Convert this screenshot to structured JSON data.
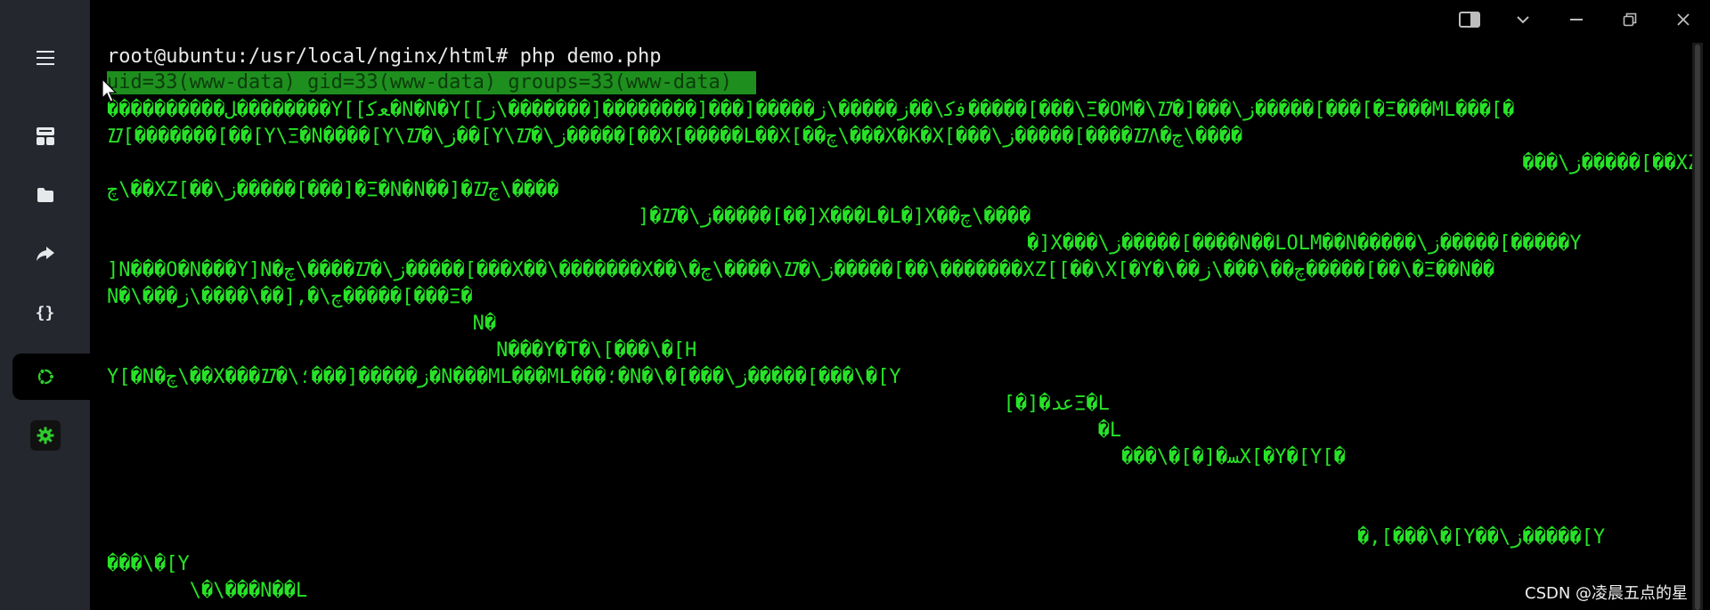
{
  "sidebar": {
    "items": [
      {
        "icon": "menu-icon"
      },
      {
        "icon": "dashboard-icon"
      },
      {
        "icon": "folder-icon"
      },
      {
        "icon": "share-icon"
      },
      {
        "icon": "braces-icon",
        "glyph": "{}"
      },
      {
        "icon": "ubuntu-terminal-icon",
        "active": true
      },
      {
        "icon": "gear-icon"
      }
    ],
    "accent": "#2ecc2e"
  },
  "window_controls": [
    "sidebar-toggle-icon",
    "chevron-down-icon",
    "minimize-icon",
    "restore-icon",
    "close-icon"
  ],
  "terminal": {
    "text_color": "#27e327",
    "prompt": "root@ubuntu:/usr/local/nginx/html# php demo.php",
    "highlight": "uid=33(www-data) gid=33(www-data) groups=33(www-data) ",
    "lines": [
      "����������ﻞ��������Y[[ﻌﮐ�N�N�Y[[ﻓﮐ\\��ﺯ�����\\ﺯ�����[���[��������[�������\\ﺯ�����[���\\Ξ�OM�\\ᮕ�]���\\ﺯ�����[���[�Ξ���ML���[�",
      "ᮕ[�������[��[Y\\Ξ�N����[Y\\ᮕ�\\ﺯ��[Y\\ᮕ�\\ﺯ�����[��X[�����L��X[��ﭺ\\���X�K�X[���\\ﺯ�����[����ᮕΛ�ﭺ\\����",
      "                                                                                                                        ���\\ﺯ�����[��XZ[����XZ[�",
      "ﭺ\\��XZ[��\\ﺯ�����[���]�Ξ�N�N��]�ᮕﭺ\\����",
      "                                             ]�ᮕ�\\ﺯ�����[��]X���L�L�]X��ﭺ\\����",
      "                                                                              �]X���\\ﺯ�����[����N��LOLM��N�����\\ﺯ�����[�����Y",
      "]N���O�N���Y]N�ﭺ\\����ᮕ�\\ﺯ�����[���X��\\�������X��\\�ﭺ\\����\\ᮕ�\\ﺯ�����[��\\�������XZ[[��\\X[�Y�\\��ﭺ��\\���\\ﺯ�����[��\\�Ξ��N��",
      "N�\\���ﭺ\\�,[��\\����\\ﺯ�����[���Ξ�",
      "                               N�",
      "                                 N���Y�T�\\[���\\�[H",
      "Y[�N�ﭺ\\��X���ᮕ�\\ﺯ�����[���؛�N���ML���ML���؛�N�\\�[���\\ﺯ�����[���\\�[Y",
      "                                                                            [�]�ﻋﺪΞ�L",
      "                                                                                    �L",
      "                                                                                      ���\\�[�]�ﺴX[�Y�[Y[�",
      "",
      "",
      "                                                                                                          �,[���\\�[Y��\\ﺯ�����[Y",
      "���\\�[Y",
      "       \\�\\���N��L"
    ]
  },
  "watermark": "CSDN @凌晨五点的星"
}
